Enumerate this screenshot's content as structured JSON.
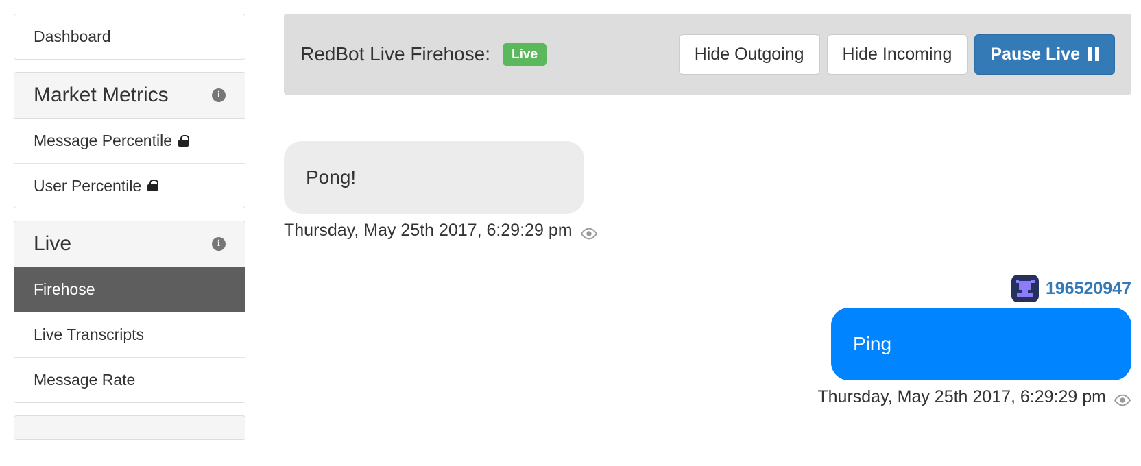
{
  "sidebar": {
    "groups": [
      {
        "name": "top-nav-panel",
        "rows": [
          {
            "label": "Dashboard",
            "type": "link",
            "locked": false,
            "active": false
          }
        ]
      },
      {
        "name": "market-metrics-panel",
        "heading": {
          "label": "Market Metrics",
          "info_icon": "info-icon"
        },
        "rows": [
          {
            "label": "Message Percentile",
            "type": "link",
            "locked": true,
            "active": false,
            "lock_icon": "lock-icon"
          },
          {
            "label": "User Percentile",
            "type": "link",
            "locked": true,
            "active": false,
            "lock_icon": "lock-icon"
          }
        ]
      },
      {
        "name": "live-panel",
        "heading": {
          "label": "Live",
          "info_icon": "info-icon"
        },
        "rows": [
          {
            "label": "Firehose",
            "type": "link",
            "locked": false,
            "active": true
          },
          {
            "label": "Live Transcripts",
            "type": "link",
            "locked": false,
            "active": false
          },
          {
            "label": "Message Rate",
            "type": "link",
            "locked": false,
            "active": false
          }
        ]
      }
    ]
  },
  "header": {
    "title": "RedBot Live Firehose:",
    "status_badge": "Live",
    "status_color": "#5cb85c",
    "buttons": [
      {
        "label": "Hide Outgoing",
        "style": "default"
      },
      {
        "label": "Hide Incoming",
        "style": "default"
      }
    ],
    "primary_button": {
      "label": "Pause Live",
      "icon": "pause-icon",
      "color": "#337ab7"
    }
  },
  "messages": [
    {
      "direction": "incoming",
      "text": "Pong!",
      "timestamp": "Thursday, May 25th 2017, 6:29:29 pm",
      "eye_icon": "eye-icon",
      "bubble_color": "#ececec"
    },
    {
      "direction": "outgoing",
      "user_id": "196520947",
      "avatar": "user-avatar",
      "text": "Ping",
      "timestamp": "Thursday, May 25th 2017, 6:29:29 pm",
      "eye_icon": "eye-icon",
      "bubble_color": "#0084ff"
    }
  ]
}
